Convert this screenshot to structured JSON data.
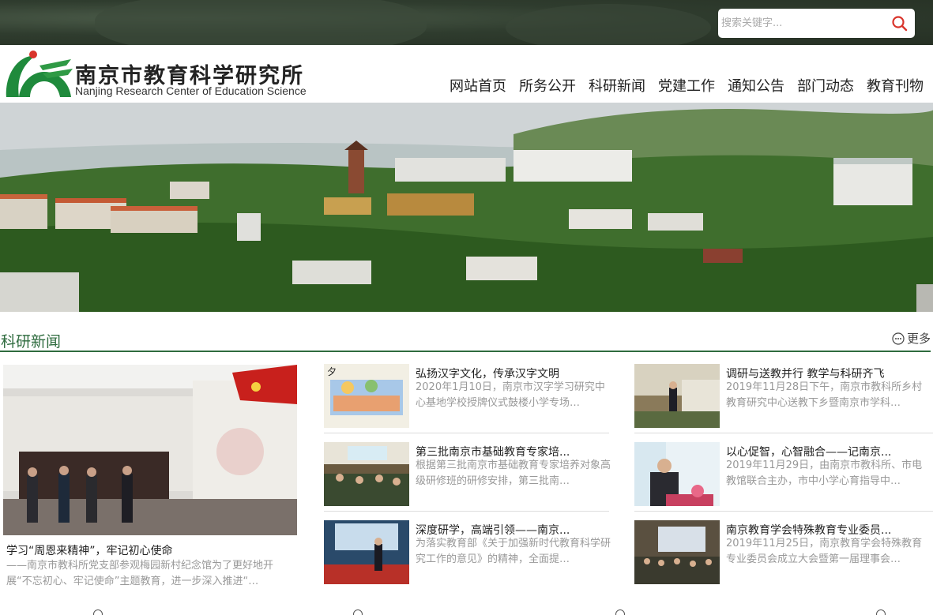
{
  "search": {
    "placeholder": "搜索关键字..."
  },
  "header": {
    "logo_cn": "南京市教育科学研究所",
    "logo_en": "Nanjing Research Center of Education Science"
  },
  "nav": [
    "网站首页",
    "所务公开",
    "科研新闻",
    "党建工作",
    "通知公告",
    "部门动态",
    "教育刊物"
  ],
  "section": {
    "title": "科研新闻",
    "more": "更多"
  },
  "featured": {
    "title": "学习“周恩来精神”，牢记初心使命",
    "desc": "——南京市教科所党支部参观梅园新村纪念馆为了更好地开展“不忘初心、牢记使命”主题教育，进一步深入推进“…"
  },
  "news": [
    {
      "title": "弘扬汉字文化，传承汉字文明",
      "desc": "2020年1月10日，南京市汉字学习研究中心基地学校授牌仪式鼓楼小学专场…"
    },
    {
      "title": "调研与送教并行 教学与科研齐飞",
      "desc": "2019年11月28日下午，南京市教科所乡村教育研究中心送教下乡暨南京市学科…"
    },
    {
      "title": "第三批南京市基础教育专家培...",
      "desc": "根据第三批南京市基础教育专家培养对象高级研修班的研修安排，第三批南…"
    },
    {
      "title": "以心促智，心智融合——记南京...",
      "desc": "2019年11月29日，由南京市教科所、市电教馆联合主办，市中小学心育指导中…"
    },
    {
      "title": "深度研学，高端引领——南京...",
      "desc": "为落实教育部《关于加强新时代教育科学研究工作的意见》的精神，全面提…"
    },
    {
      "title": "南京教育学会特殊教育专业委员...",
      "desc": "2019年11月25日，南京教育学会特殊教育专业委员会成立大会暨第一届理事会…"
    }
  ],
  "colors": {
    "brand_green": "#2e6b3e",
    "topbar": "#2f3c2e",
    "search_icon": "#d9342b"
  }
}
